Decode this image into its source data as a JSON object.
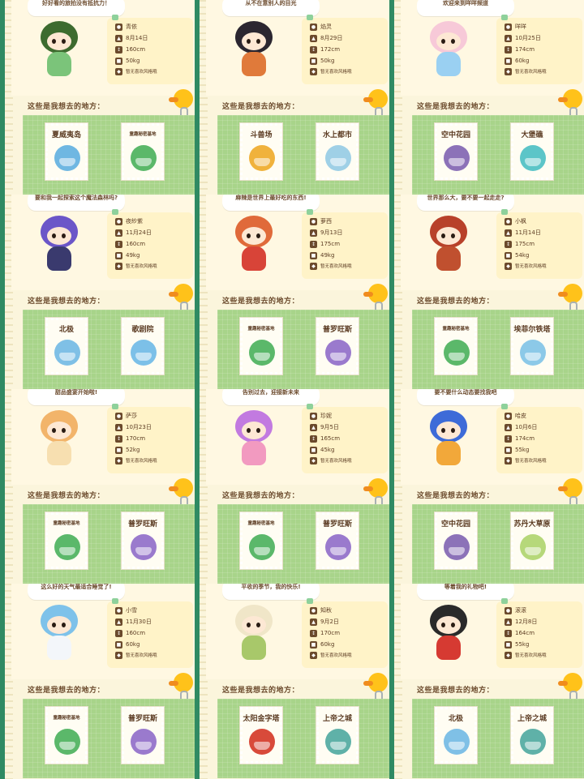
{
  "section_title": "这些是我想去的地方：",
  "favorite_label": "暂无喜欢风格哦",
  "cards": [
    {
      "speech": "好好看的旅拍没有抵抗力！",
      "name": "青依",
      "birthday": "8月14日",
      "height": "160cm",
      "weight": "50kg",
      "color_hair": "#3d6b2f",
      "color_body": "#7bc47a",
      "places": [
        {
          "name": "夏威夷岛",
          "color": "#6fb7e2"
        },
        {
          "name": "童趣秘密基地",
          "color": "#5bb86a"
        }
      ]
    },
    {
      "speech": "从不在意别人的目光",
      "name": "焰灵",
      "birthday": "8月29日",
      "height": "172cm",
      "weight": "50kg",
      "color_hair": "#2b2630",
      "color_body": "#e07a3a",
      "places": [
        {
          "name": "斗兽场",
          "color": "#f0b23c"
        },
        {
          "name": "水上都市",
          "color": "#9fd0e6"
        }
      ]
    },
    {
      "speech": "欢迎来到咩咩频道",
      "name": "咩咩",
      "birthday": "10月25日",
      "height": "174cm",
      "weight": "60kg",
      "color_hair": "#f7c9d8",
      "color_body": "#9ad0f2",
      "places": [
        {
          "name": "空中花园",
          "color": "#8c72b8"
        },
        {
          "name": "大堡礁",
          "color": "#5cc5c8"
        }
      ]
    },
    {
      "speech": "要和我一起探索这个魔法森林吗?",
      "name": "夜紗紫",
      "birthday": "11月24日",
      "height": "160cm",
      "weight": "49kg",
      "color_hair": "#6b56c8",
      "color_body": "#3a3a6e",
      "places": [
        {
          "name": "北极",
          "color": "#7fc0e6"
        },
        {
          "name": "歌剧院",
          "color": "#7cc0e8"
        }
      ]
    },
    {
      "speech": "麻辣是世界上最好吃的东西!",
      "name": "萝西",
      "birthday": "9月13日",
      "height": "175cm",
      "weight": "49kg",
      "color_hair": "#e06a3a",
      "color_body": "#d84438",
      "places": [
        {
          "name": "童趣秘密基地",
          "color": "#5bb86a"
        },
        {
          "name": "普罗旺斯",
          "color": "#9a7acd"
        }
      ]
    },
    {
      "speech": "世界那么大，要不要一起走走?",
      "name": "小枫",
      "birthday": "11月14日",
      "height": "175cm",
      "weight": "54kg",
      "color_hair": "#b8412a",
      "color_body": "#c0502f",
      "places": [
        {
          "name": "童趣秘密基地",
          "color": "#5bb86a"
        },
        {
          "name": "埃菲尔铁塔",
          "color": "#8cc9e8"
        }
      ]
    },
    {
      "speech": "甜品盛宴开始啦!",
      "name": "萨莎",
      "birthday": "10月23日",
      "height": "170cm",
      "weight": "52kg",
      "color_hair": "#f2b46a",
      "color_body": "#f7dfb0",
      "places": [
        {
          "name": "童趣秘密基地",
          "color": "#5bb86a"
        },
        {
          "name": "普罗旺斯",
          "color": "#9a7acd"
        }
      ]
    },
    {
      "speech": "告别过去，迎接新未来",
      "name": "珍妮",
      "birthday": "9月5日",
      "height": "165cm",
      "weight": "45kg",
      "color_hair": "#c27ae0",
      "color_body": "#f29ac0",
      "places": [
        {
          "name": "童趣秘密基地",
          "color": "#5bb86a"
        },
        {
          "name": "普罗旺斯",
          "color": "#9a7acd"
        }
      ]
    },
    {
      "speech": "要不要什么动态要找我吧",
      "name": "哈皮",
      "birthday": "10月6日",
      "height": "174cm",
      "weight": "55kg",
      "color_hair": "#3d6bd8",
      "color_body": "#f2a83a",
      "places": [
        {
          "name": "空中花园",
          "color": "#8c72b8"
        },
        {
          "name": "苏丹大草原",
          "color": "#b6d87a"
        }
      ]
    },
    {
      "speech": "这么好的天气最适合睡觉了!",
      "name": "小雪",
      "birthday": "11月30日",
      "height": "160cm",
      "weight": "60kg",
      "color_hair": "#7ec2ea",
      "color_body": "#f3f6fa",
      "places": [
        {
          "name": "童趣秘密基地",
          "color": "#5bb86a"
        },
        {
          "name": "普罗旺斯",
          "color": "#9a7acd"
        }
      ]
    },
    {
      "speech": "平收的季节，我的快乐!",
      "name": "知秋",
      "birthday": "9月2日",
      "height": "170cm",
      "weight": "60kg",
      "color_hair": "#f0e6c8",
      "color_body": "#a8c86a",
      "places": [
        {
          "name": "太阳金字塔",
          "color": "#d84a3a"
        },
        {
          "name": "上帝之城",
          "color": "#5fb1a8"
        }
      ]
    },
    {
      "speech": "等着我的礼物吧!",
      "name": "滚滚",
      "birthday": "12月8日",
      "height": "164cm",
      "weight": "55kg",
      "color_hair": "#2a2a2a",
      "color_body": "#d63a32",
      "places": [
        {
          "name": "北极",
          "color": "#7fc0e6"
        },
        {
          "name": "上帝之城",
          "color": "#5fb1a8"
        }
      ]
    }
  ]
}
